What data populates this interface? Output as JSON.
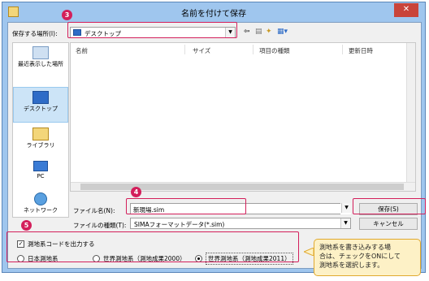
{
  "window": {
    "title": "名前を付けて保存",
    "close_icon": "close-icon"
  },
  "location": {
    "label": "保存する場所(I):",
    "value": "デスクトップ"
  },
  "places": [
    {
      "label": "最近表示した場所",
      "icon": "recent-places-icon"
    },
    {
      "label": "デスクトップ",
      "icon": "desktop-icon"
    },
    {
      "label": "ライブラリ",
      "icon": "library-icon"
    },
    {
      "label": "PC",
      "icon": "pc-icon"
    },
    {
      "label": "ネットワーク",
      "icon": "network-icon"
    }
  ],
  "columns": [
    "名前",
    "サイズ",
    "項目の種類",
    "更新日時"
  ],
  "filename": {
    "label": "ファイル名(N):",
    "value": "新現場.sim"
  },
  "filetype": {
    "label": "ファイルの種類(T):",
    "value": "SIMAフォーマットデータ(*.sim)"
  },
  "buttons": {
    "save": "保存(S)",
    "cancel": "キャンセル"
  },
  "coordinate_output": {
    "label": "測地系コードを出力する",
    "checked": true
  },
  "datum_options": [
    {
      "label": "日本測地系",
      "selected": false
    },
    {
      "label": "世界測地系（測地成果2000）",
      "selected": false
    },
    {
      "label": "世界測地系（測地成果2011）",
      "selected": true
    }
  ],
  "callouts": {
    "n3": "3",
    "n4": "4",
    "n5": "5",
    "accent": "#d31f5b"
  },
  "tip": {
    "line1": "測地系を書き込みする場",
    "line2": "合は、チェックをONにして",
    "line3": "測地系を選択します。"
  }
}
